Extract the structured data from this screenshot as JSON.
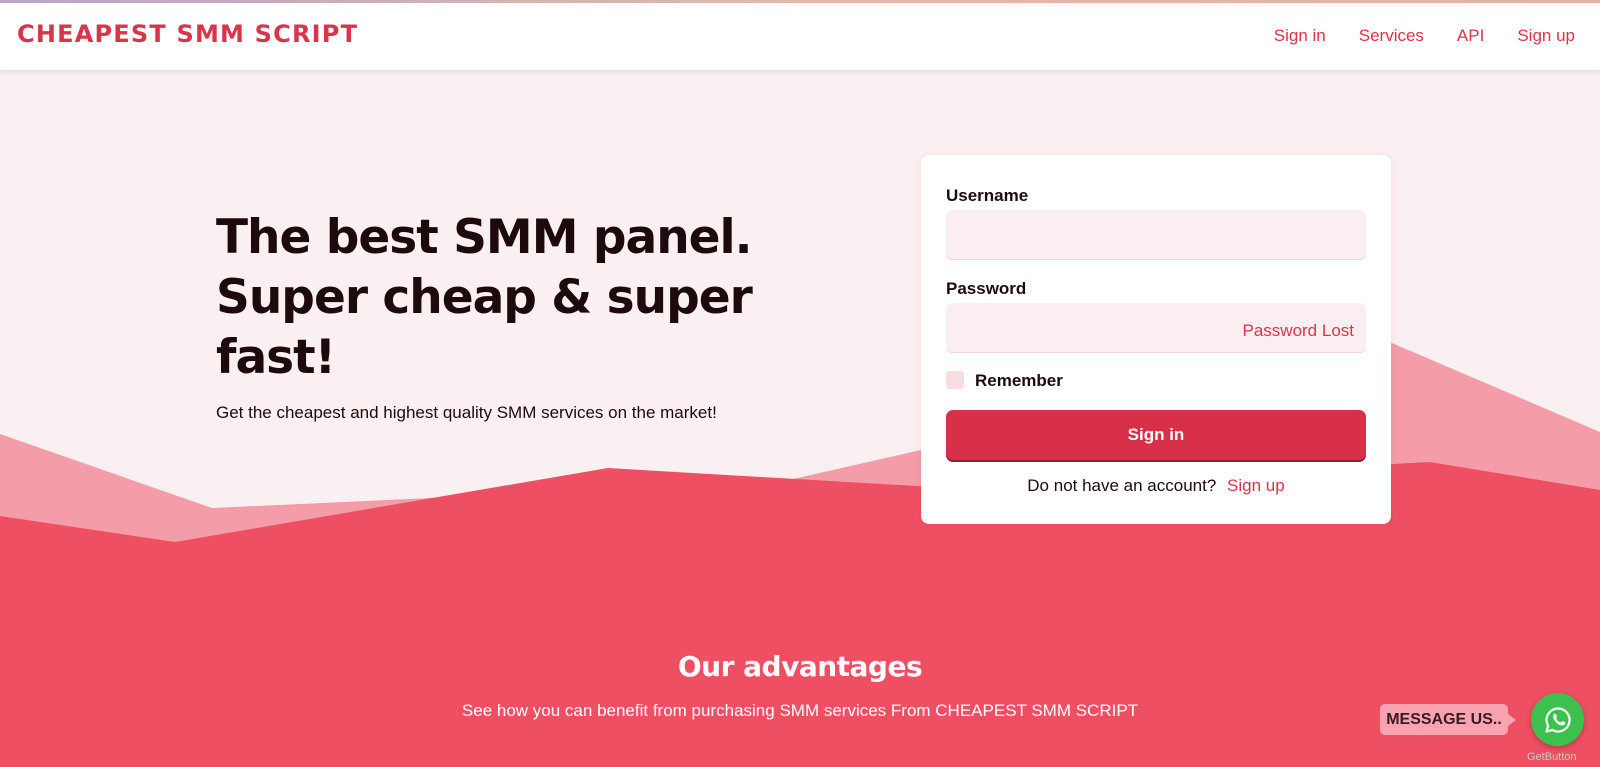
{
  "header": {
    "brand": "CHEAPEST SMM SCRIPT",
    "nav": [
      "Sign in",
      "Services",
      "API",
      "Sign up"
    ]
  },
  "hero": {
    "title": "The best SMM panel. Super cheap & super fast!",
    "subtitle": "Get the cheapest and highest quality SMM services on the market!"
  },
  "login": {
    "username_label": "Username",
    "username_value": "",
    "password_label": "Password",
    "password_value": "",
    "password_lost": "Password Lost",
    "remember_label": "Remember",
    "remember_checked": false,
    "signin_button": "Sign in",
    "no_account_text": "Do not have an account?",
    "signup_link": "Sign up"
  },
  "advantages": {
    "title": "Our advantages",
    "subtitle": "See how you can benefit from purchasing SMM services From CHEAPEST SMM SCRIPT"
  },
  "widget": {
    "message_label": "MESSAGE US..",
    "credit": "GetButton",
    "icon": "whatsapp-icon"
  },
  "colors": {
    "accent": "#d9344a",
    "background": "#fbf0f1",
    "wave_light": "#f49da8",
    "wave_dark": "#ef4f62",
    "whatsapp": "#3cc14e"
  }
}
